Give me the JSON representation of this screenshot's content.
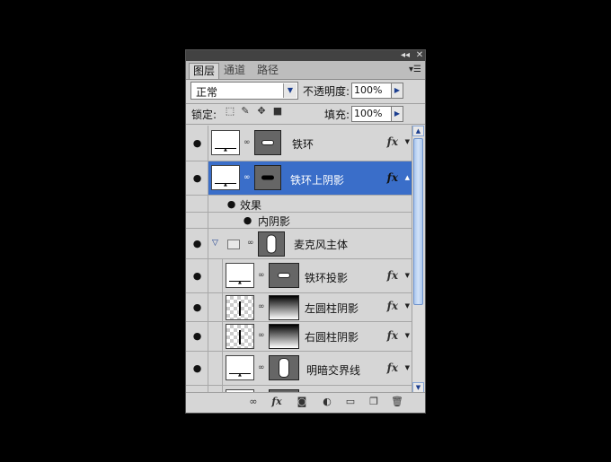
{
  "tabs": [
    {
      "label": "图层",
      "active": true
    },
    {
      "label": "通道",
      "active": false
    },
    {
      "label": "路径",
      "active": false
    }
  ],
  "titlebar": {
    "collapse_icon": "double-chevron-left-icon",
    "close_icon": "close-icon"
  },
  "blend_mode": {
    "value": "正常"
  },
  "opacity": {
    "label": "不透明度:",
    "value": "100%"
  },
  "lock": {
    "label": "锁定:",
    "icons": [
      "lock-transparent-icon",
      "lock-brush-icon",
      "lock-move-icon",
      "lock-all-icon"
    ]
  },
  "fill": {
    "label": "填充:",
    "value": "100%"
  },
  "layers": [
    {
      "name": "铁环",
      "fx": "fx",
      "selected": false
    },
    {
      "name": "铁环上阴影",
      "fx": "fx",
      "selected": true
    },
    {
      "name": "效果"
    },
    {
      "name": "内阴影"
    },
    {
      "name": "麦克风主体",
      "group": true
    },
    {
      "name": "铁环投影",
      "fx": "fx"
    },
    {
      "name": "左圆柱阴影",
      "fx": "fx"
    },
    {
      "name": "右圆柱阴影",
      "fx": "fx"
    },
    {
      "name": "明暗交界线",
      "fx": "fx"
    }
  ],
  "bottom_icons": [
    "link-icon",
    "fx-icon",
    "mask-icon",
    "adjustment-icon",
    "folder-icon",
    "new-layer-icon",
    "trash-icon"
  ],
  "colors": {
    "selection": "#3a6ec9",
    "panel_bg": "#d6d6d6",
    "background": "#000000"
  }
}
